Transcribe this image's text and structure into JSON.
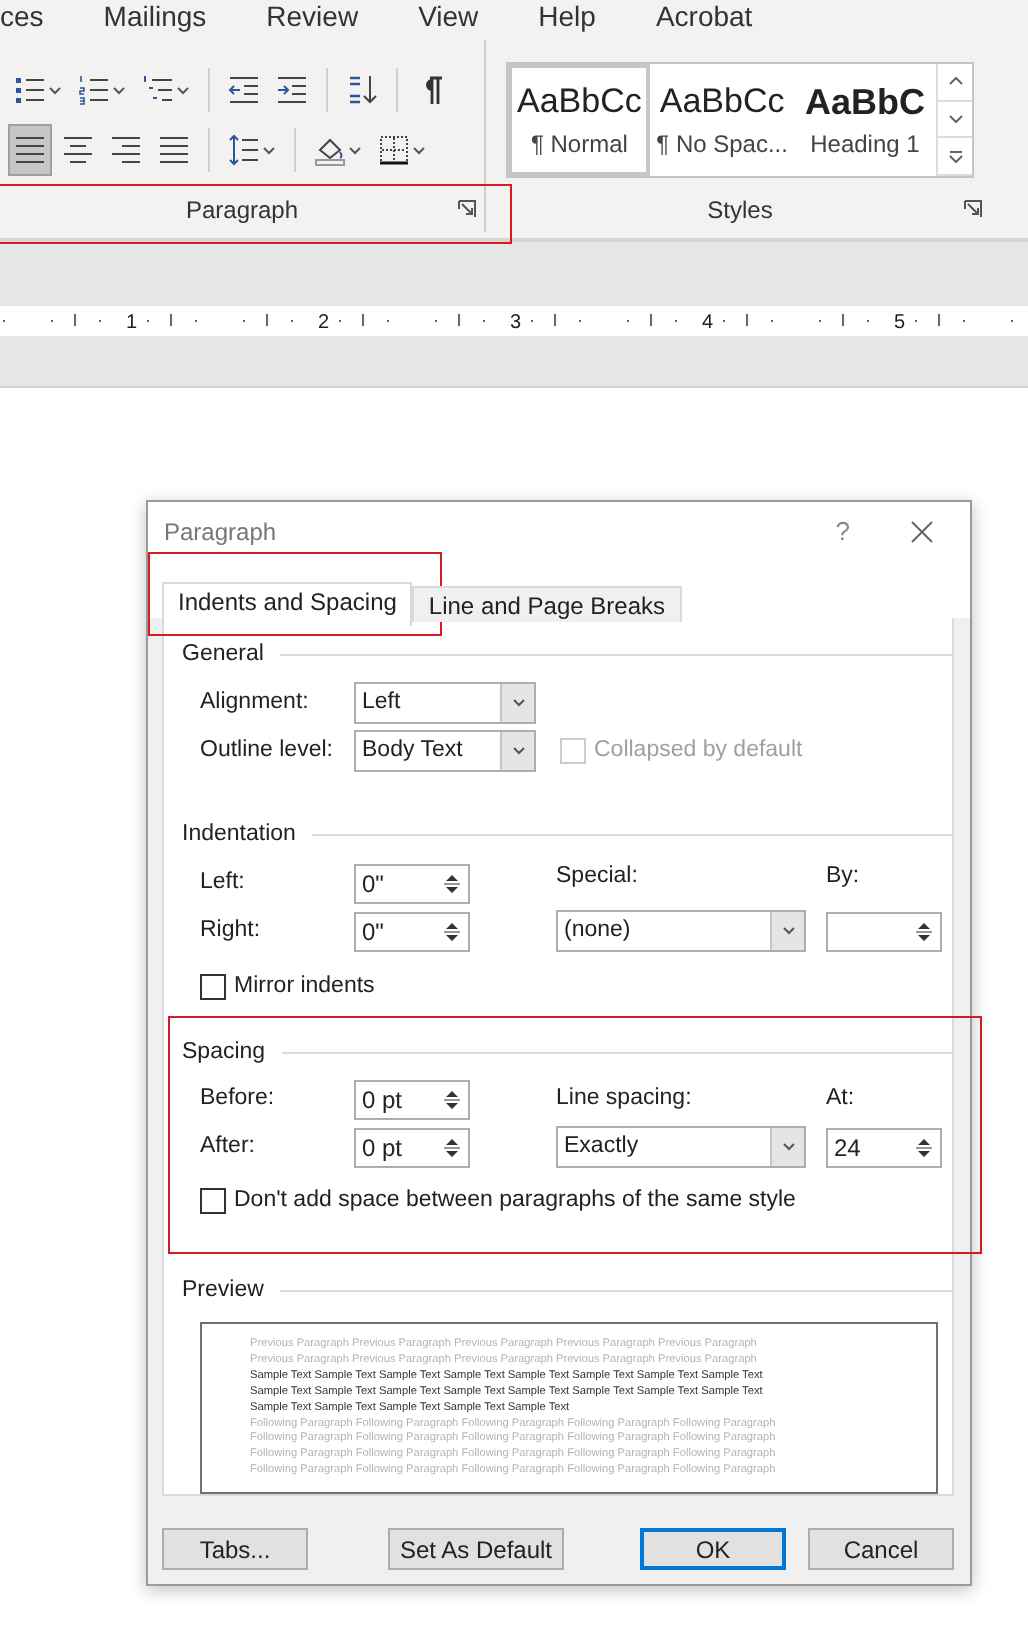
{
  "ribbon_tabs": [
    "ces",
    "Mailings",
    "Review",
    "View",
    "Help",
    "Acrobat"
  ],
  "ribbon": {
    "paragraph_group": {
      "label": "Paragraph",
      "highlighted": true,
      "rows": [
        [
          {
            "kind": "bullets",
            "dropdown": true
          },
          {
            "kind": "numbering",
            "dropdown": true
          },
          {
            "kind": "multilevel",
            "dropdown": true
          },
          {
            "kind": "separator"
          },
          {
            "kind": "decrease-indent",
            "dropdown": false
          },
          {
            "kind": "increase-indent",
            "dropdown": false
          },
          {
            "kind": "separator"
          },
          {
            "kind": "sort",
            "dropdown": false
          },
          {
            "kind": "separator"
          },
          {
            "kind": "pilcrow",
            "dropdown": false
          }
        ],
        [
          {
            "kind": "align-left",
            "dropdown": false,
            "selected": true
          },
          {
            "kind": "align-center",
            "dropdown": false,
            "selected": false
          },
          {
            "kind": "align-right",
            "dropdown": false,
            "selected": false
          },
          {
            "kind": "justify",
            "dropdown": false,
            "selected": false
          },
          {
            "kind": "separator"
          },
          {
            "kind": "line-spacing",
            "dropdown": true
          },
          {
            "kind": "separator"
          },
          {
            "kind": "shading",
            "dropdown": true
          },
          {
            "kind": "borders",
            "dropdown": true
          }
        ]
      ]
    },
    "styles_group": {
      "label": "Styles",
      "items": [
        {
          "preview": "AaBbCc",
          "name": "¶ Normal",
          "kind": "body",
          "selected": true
        },
        {
          "preview": "AaBbCc",
          "name": "¶ No Spac...",
          "kind": "body",
          "selected": false
        },
        {
          "preview": "AaBbC",
          "name": "Heading 1",
          "kind": "heading",
          "selected": false
        }
      ]
    }
  },
  "ruler": {
    "numbers": [
      "1",
      "2",
      "3",
      "4",
      "5"
    ]
  },
  "dialog": {
    "title": "Paragraph",
    "help": "?",
    "tabs": [
      {
        "label": "Indents and Spacing",
        "selected": true,
        "highlighted": true
      },
      {
        "label": "Line and Page Breaks",
        "selected": false,
        "highlighted": false
      }
    ],
    "general": {
      "heading": "General",
      "alignment": {
        "label": "Alignment:",
        "value": "Left"
      },
      "outline_level": {
        "label": "Outline level:",
        "value": "Body Text"
      },
      "collapsed": {
        "label": "Collapsed by default",
        "checked": false,
        "disabled": true
      }
    },
    "indentation": {
      "heading": "Indentation",
      "left": {
        "label": "Left:",
        "value": "0\""
      },
      "right": {
        "label": "Right:",
        "value": "0\""
      },
      "special": {
        "label": "Special:",
        "value": "(none)"
      },
      "by": {
        "label": "By:"
      },
      "mirror": {
        "label": "Mirror indents",
        "checked": false
      }
    },
    "spacing": {
      "heading": "Spacing",
      "highlighted": true,
      "before": {
        "label": "Before:",
        "value": "0 pt"
      },
      "after": {
        "label": "After:",
        "value": "0 pt"
      },
      "line_spacing": {
        "label": "Line spacing:",
        "value": "Exactly"
      },
      "at": {
        "label": "At:",
        "value": "24"
      },
      "dont_add": {
        "label": "Don't add space between paragraphs of the same style",
        "checked": false
      }
    },
    "preview": {
      "heading": "Preview",
      "lines": [
        {
          "kind": "previous",
          "text": "Previous Paragraph Previous Paragraph Previous Paragraph Previous Paragraph Previous Paragraph"
        },
        {
          "kind": "previous",
          "text": "Previous Paragraph Previous Paragraph Previous Paragraph Previous Paragraph Previous Paragraph"
        },
        {
          "kind": "sample",
          "text": "Sample Text Sample Text Sample Text Sample Text Sample Text Sample Text Sample Text Sample Text"
        },
        {
          "kind": "sample",
          "text": "Sample Text Sample Text Sample Text Sample Text Sample Text Sample Text Sample Text Sample Text"
        },
        {
          "kind": "sample",
          "text": "Sample Text Sample Text Sample Text Sample Text Sample Text"
        },
        {
          "kind": "following",
          "text": "Following Paragraph Following Paragraph Following Paragraph Following Paragraph Following Paragraph"
        },
        {
          "kind": "following",
          "text": "Following Paragraph Following Paragraph Following Paragraph Following Paragraph Following Paragraph"
        },
        {
          "kind": "following",
          "text": "Following Paragraph Following Paragraph Following Paragraph Following Paragraph Following Paragraph"
        },
        {
          "kind": "following",
          "text": "Following Paragraph Following Paragraph Following Paragraph Following Paragraph Following Paragraph"
        }
      ]
    },
    "buttons": [
      {
        "label": "Tabs...",
        "default": false
      },
      {
        "label": "Set As Default",
        "default": false
      },
      {
        "label": "OK",
        "default": true
      },
      {
        "label": "Cancel",
        "default": false
      }
    ]
  }
}
